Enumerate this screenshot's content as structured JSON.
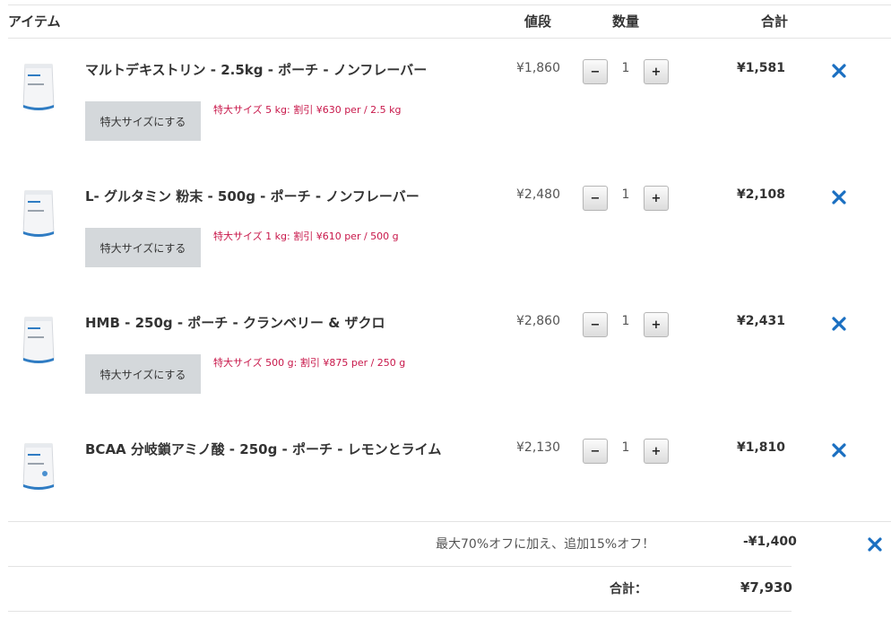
{
  "header": {
    "item": "アイテム",
    "price": "値段",
    "quantity": "数量",
    "total": "合計"
  },
  "items": [
    {
      "name": "マルトデキストリン - 2.5kg - ポーチ - ノンフレーバー",
      "upsize_label": "特大サイズにする",
      "promo": "特大サイズ 5 kg: 割引 ¥630 per / 2.5 kg",
      "price": "¥1,860",
      "qty": "1",
      "total": "¥1,581"
    },
    {
      "name": "L- グルタミン 粉末 - 500g - ポーチ - ノンフレーバー",
      "upsize_label": "特大サイズにする",
      "promo": "特大サイズ 1 kg: 割引 ¥610 per / 500 g",
      "price": "¥2,480",
      "qty": "1",
      "total": "¥2,108"
    },
    {
      "name": "HMB - 250g - ポーチ - クランベリー & ザクロ",
      "upsize_label": "特大サイズにする",
      "promo": "特大サイズ 500 g: 割引 ¥875 per / 250 g",
      "price": "¥2,860",
      "qty": "1",
      "total": "¥2,431"
    },
    {
      "name": "BCAA 分岐鎖アミノ酸 - 250g - ポーチ - レモンとライム",
      "price": "¥2,130",
      "qty": "1",
      "total": "¥1,810"
    }
  ],
  "qty_controls": {
    "minus": "−",
    "plus": "+"
  },
  "discount": {
    "label": "最大70%オフに加え、追加15%オフ！",
    "value": "-¥1,400"
  },
  "grand_total": {
    "label": "合計：",
    "value": "¥7,930"
  },
  "colors": {
    "promo": "#c8174a",
    "remove_icon": "#1a6fc1",
    "upsize_button_bg": "#d4d8db"
  },
  "icons": {
    "remove": "close-icon",
    "product": "product-pouch-icon"
  }
}
